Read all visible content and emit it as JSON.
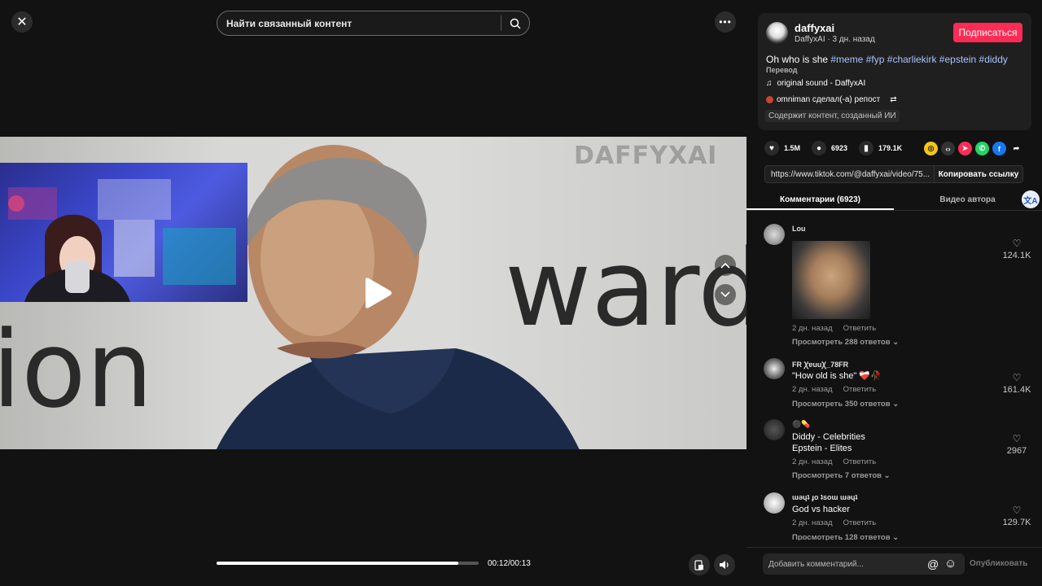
{
  "search": {
    "placeholder": "Найти связанный контент"
  },
  "player": {
    "watermark": "DAFFYXAI",
    "bg_text_left": "ion",
    "bg_text_right": "ward",
    "time": "00:12/00:13",
    "progress": 0.923
  },
  "author": {
    "username": "daffyxai",
    "meta": "DaffyxAI · 3 дн. назад",
    "follow_label": "Подписаться",
    "desc_text": "Oh who is she ",
    "hashtags": [
      "#meme",
      "#fyp",
      "#charliekirk",
      "#epstein",
      "#diddy"
    ],
    "translate_label": "Перевод",
    "sound": "original sound - DaffyxAI",
    "repost": "omniman сделал(-а) репост",
    "ai_badge": "Содержит контент, созданный ИИ"
  },
  "stats": {
    "likes": "1.5M",
    "comments": "6923",
    "saves": "179.1K"
  },
  "share": {
    "url": "https://www.tiktok.com/@daffyxai/video/75...",
    "copy_label": "Копировать ссылку",
    "colors": [
      "#f5c518",
      "#333333",
      "#fe2c55",
      "#25d366",
      "#1877f2"
    ]
  },
  "tabs": [
    {
      "label": "Комментарии (6923)"
    },
    {
      "label": "Видео автора"
    }
  ],
  "comments": [
    {
      "user": "Lou",
      "text": "",
      "time": "2 дн. назад",
      "reply": "Ответить",
      "replies": "Просмотреть 288 ответов ⌄",
      "likes": "124.1K"
    },
    {
      "user": "FR ꞳɐuuꞳ_78FR",
      "text": "\"How old is she\" ❤️‍🩹🥀",
      "time": "2 дн. назад",
      "reply": "Ответить",
      "replies": "Просмотреть 350 ответов ⌄",
      "likes": "161.4K"
    },
    {
      "user": "⚫💊",
      "text": "Diddy - Celebrities\nEpstein - Elites",
      "time": "2 дн. назад",
      "reply": "Ответить",
      "replies": "Просмотреть 7 ответов ⌄",
      "likes": "2967"
    },
    {
      "user": "ɯǝɥʇ ɟo ʇsoɯ ɯǝɥʇ",
      "text": "God vs hacker",
      "time": "2 дн. назад",
      "reply": "Ответить",
      "replies": "Просмотреть 128 ответов ⌄",
      "likes": "129.7K"
    }
  ],
  "comment_bar": {
    "placeholder": "Добавить комментарий...",
    "post_label": "Опубликовать"
  }
}
